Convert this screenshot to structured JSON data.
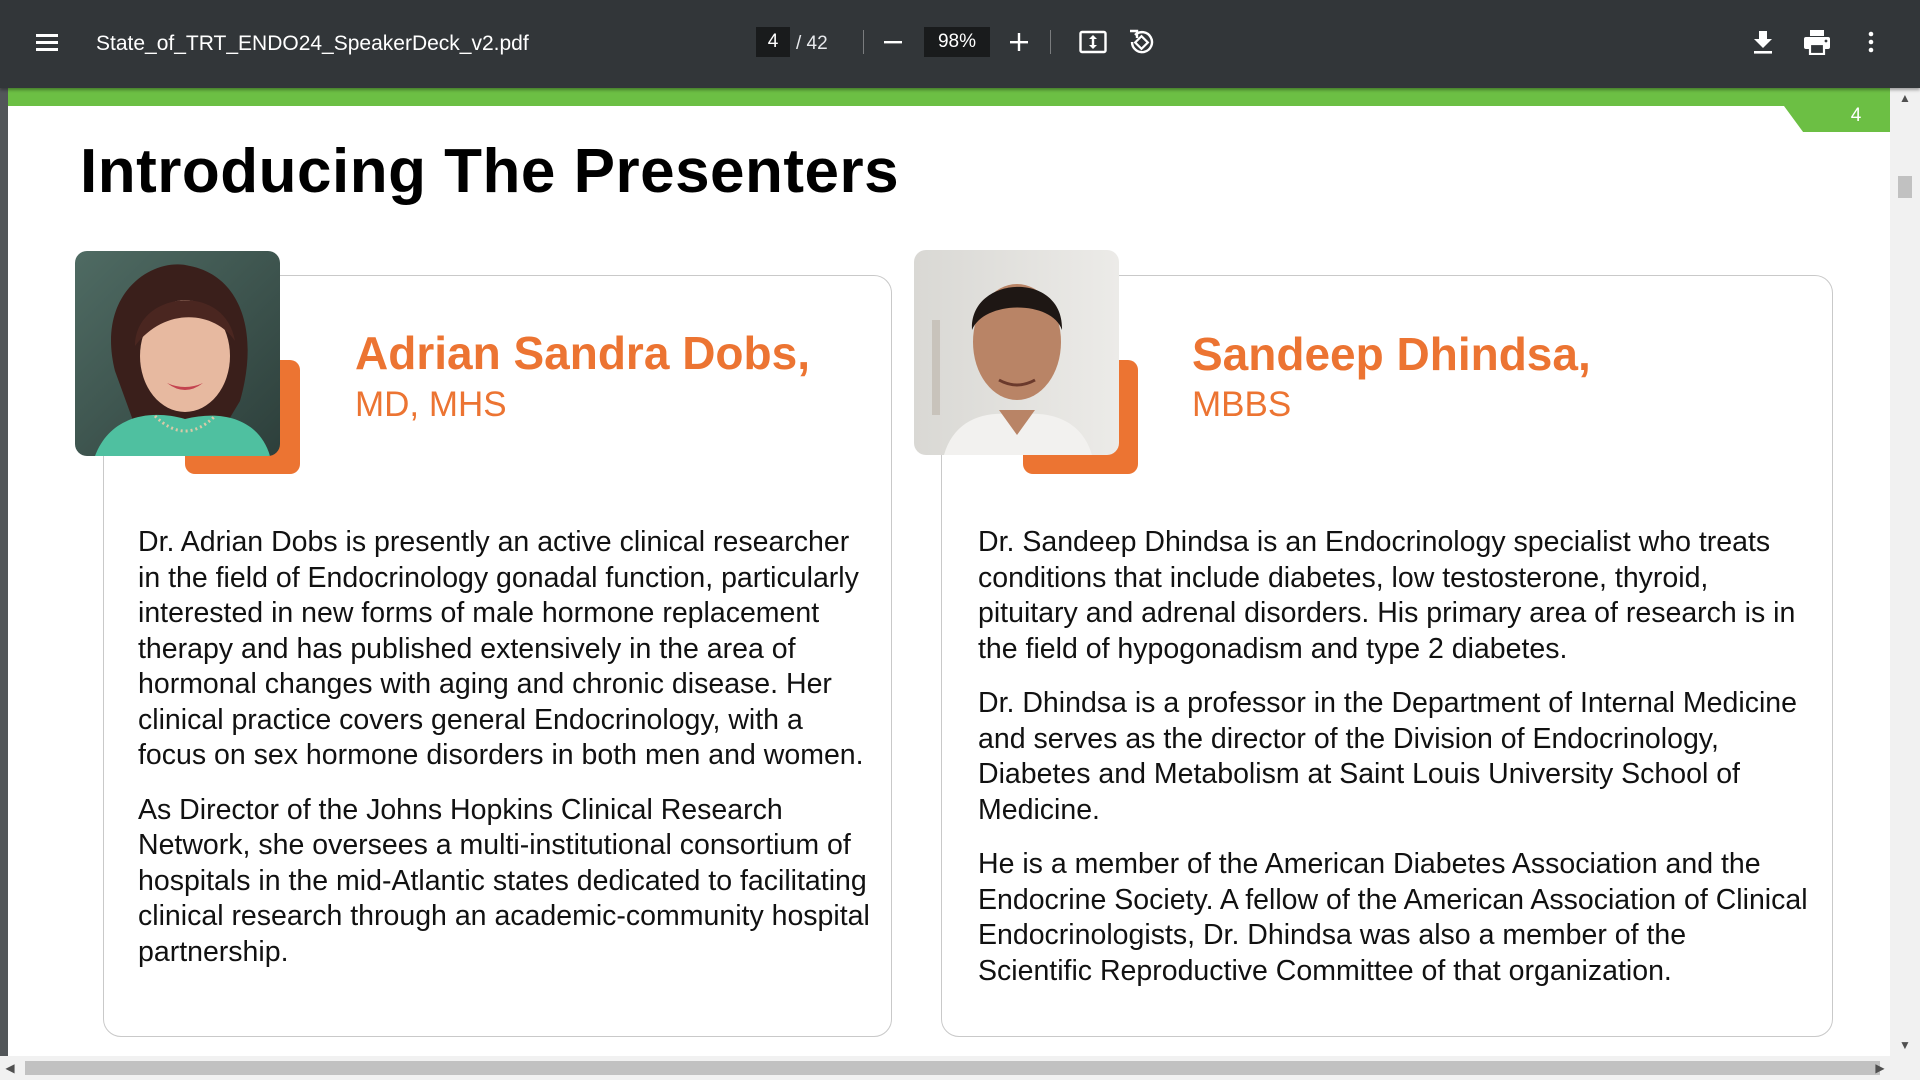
{
  "toolbar": {
    "title": "State_of_TRT_ENDO24_SpeakerDeck_v2.pdf",
    "page_current": "4",
    "page_total": "/ 42",
    "zoom": "98%",
    "icons": [
      "menu-icon",
      "minus-icon",
      "plus-icon",
      "fit-page-icon",
      "rotate-icon",
      "download-icon",
      "print-icon",
      "more-vert-icon"
    ]
  },
  "slide": {
    "page_number": "4",
    "title": "Introducing The Presenters",
    "accent_color": "#ec7432",
    "bar_color": "#6cbf44",
    "presenters": [
      {
        "name": "Adrian Sandra Dobs,",
        "credentials": "MD, MHS",
        "bio": [
          "Dr. Adrian Dobs is presently an active clinical researcher in the field of Endocrinology gonadal function, particularly interested in new forms of male hormone replacement therapy and has published extensively in the area of hormonal changes with aging and chronic disease. Her clinical practice covers general Endocrinology, with a focus on sex hormone disorders in both men and women.",
          "As Director of the Johns Hopkins Clinical Research Network, she oversees a multi-institutional consortium of hospitals in the mid-Atlantic states dedicated to facilitating clinical research through an academic-community hospital partnership."
        ]
      },
      {
        "name": "Sandeep Dhindsa,",
        "credentials": "MBBS",
        "bio": [
          "Dr. Sandeep Dhindsa is an Endocrinology specialist who treats conditions that include diabetes, low testosterone, thyroid, pituitary and adrenal disorders. His primary area of research is in the field of hypogonadism and type 2 diabetes.",
          "Dr. Dhindsa is a professor in the Department of Internal Medicine and serves as the director of the Division of Endocrinology, Diabetes and Metabolism at Saint Louis University School of Medicine.",
          "He is a member of the American Diabetes Association and the Endocrine Society. A fellow of the American Association of Clinical Endocrinologists, Dr. Dhindsa was also a member of the Scientific Reproductive Committee of that organization."
        ]
      }
    ]
  }
}
